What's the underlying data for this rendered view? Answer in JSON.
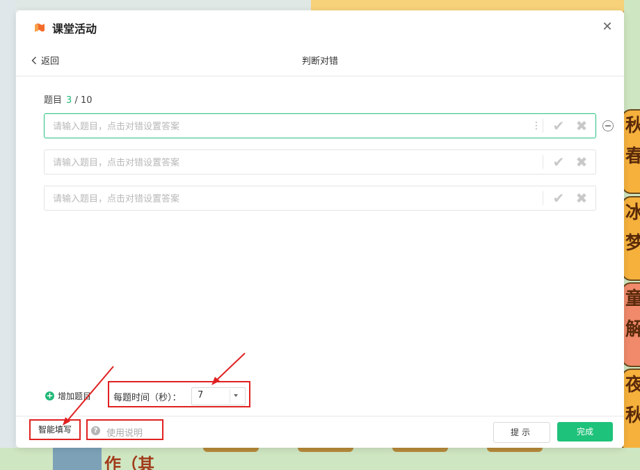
{
  "window": {
    "title": "课堂活动",
    "close_label": "✕"
  },
  "nav": {
    "back_label": "返回",
    "page_title": "判断对错"
  },
  "questions": {
    "label": "题目",
    "current": "3",
    "total": "/ 10",
    "placeholder": "请输入题目，点击对错设置答案",
    "items": [
      {
        "value": ""
      },
      {
        "value": ""
      },
      {
        "value": ""
      }
    ]
  },
  "controls": {
    "add_question": "增加题目",
    "time_label": "每题时间（秒）：",
    "time_value": "7"
  },
  "footer": {
    "smart_fill": "智能填写",
    "help": "使用说明",
    "hint_button": "提示",
    "done_button": "完成"
  },
  "background": {
    "bottom_text": "作（其",
    "cards": [
      "秋",
      "春",
      "冰",
      "梦",
      "童",
      "解",
      "夜",
      "秋"
    ]
  },
  "colors": {
    "accent_green": "#1fc27a",
    "annotation_red": "#e02020",
    "active_border": "#24c27f"
  },
  "icons": {
    "logo": "orange-flag-icon",
    "close": "close-icon",
    "back": "chevron-left-icon",
    "correct": "check-icon",
    "wrong": "cross-icon",
    "remove": "minus-circle-icon",
    "add": "plus-circle-icon",
    "help": "question-circle-icon"
  }
}
